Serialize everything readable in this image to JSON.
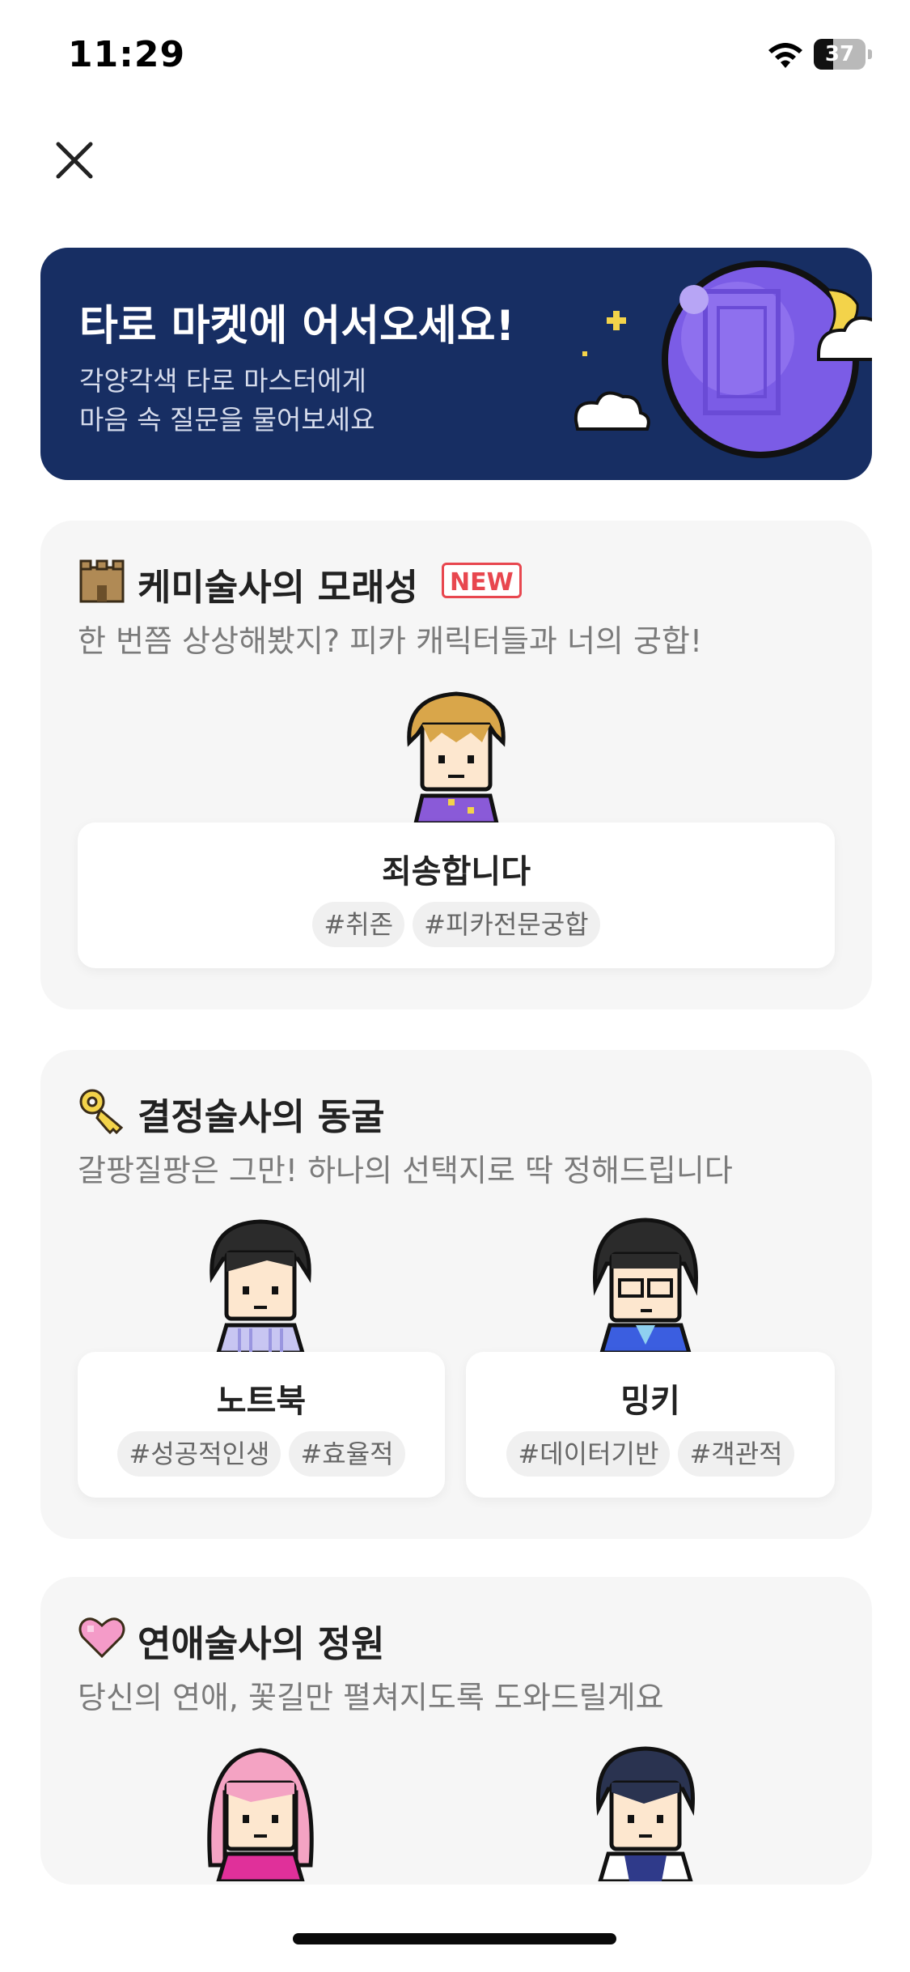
{
  "status": {
    "time": "11:29",
    "battery_level": "37",
    "battery_fraction": 0.37
  },
  "nav": {
    "close_icon": "close-icon"
  },
  "hero": {
    "title": "타로 마켓에 어서오세요!",
    "subtitle_line1": "각양각색 타로 마스터에게",
    "subtitle_line2": "마음 속 질문을 물어보세요",
    "art_icon": "purple-planet-cloud-icon",
    "background_color": "#172e63"
  },
  "sections": [
    {
      "icon": "sand-castle-icon",
      "title": "케미술사의 모래성",
      "badge": "NEW",
      "subtitle": "한 번쯤 상상해봤지? 피카 캐릭터들과 너의 궁합!",
      "readers": [
        {
          "name": "죄송합니다",
          "tags": [
            "#취존",
            "#피카전문궁합"
          ]
        }
      ]
    },
    {
      "icon": "key-icon",
      "title": "결정술사의 동굴",
      "subtitle": "갈팡질팡은 그만! 하나의 선택지로 딱 정해드립니다",
      "readers": [
        {
          "name": "노트북",
          "tags": [
            "#성공적인생",
            "#효율적"
          ]
        },
        {
          "name": "밍키",
          "tags": [
            "#데이터기반",
            "#객관적"
          ]
        }
      ]
    },
    {
      "icon": "heart-icon",
      "title": "연애술사의 정원",
      "subtitle": "당신의 연애, 꽃길만 펼쳐지도록 도와드릴게요"
    }
  ],
  "colors": {
    "accent_red": "#e8474f",
    "card_bg": "#f6f6f6",
    "tag_bg": "#f0f0f0"
  }
}
